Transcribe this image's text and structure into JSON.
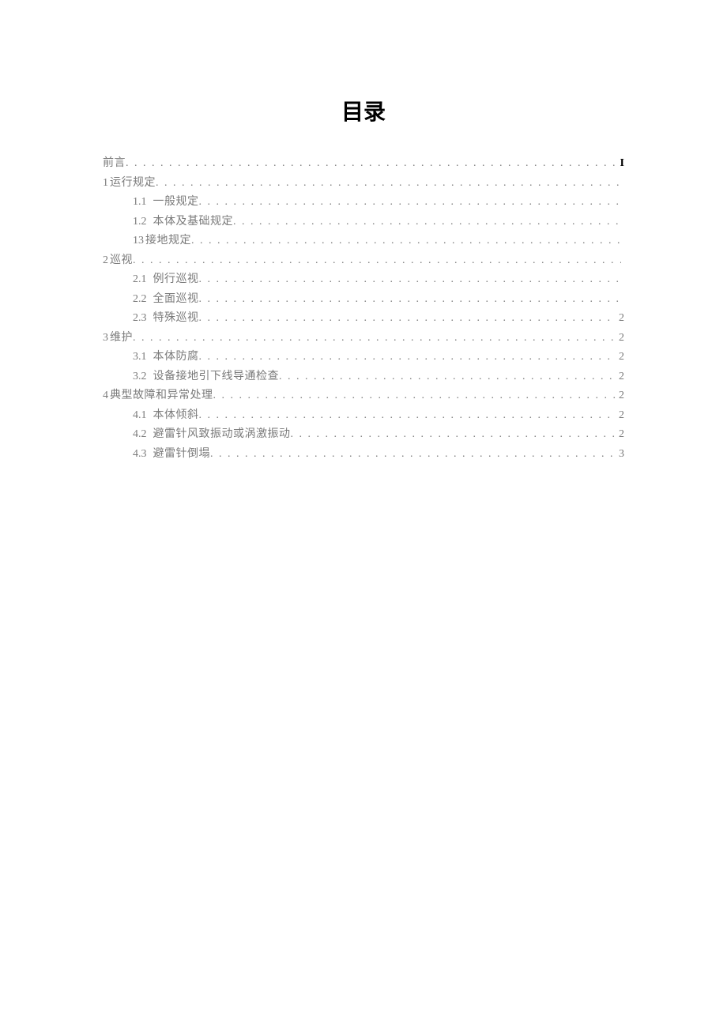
{
  "title": "目录",
  "entries": [
    {
      "level": 0,
      "num": "",
      "numTight": false,
      "title": "前言",
      "page": "I",
      "pageBold": true
    },
    {
      "level": 0,
      "num": "1",
      "numTight": true,
      "title": "运行规定",
      "page": "",
      "pageBold": false
    },
    {
      "level": 1,
      "num": "1.1",
      "numTight": false,
      "title": "一般规定",
      "page": "",
      "pageBold": false
    },
    {
      "level": 1,
      "num": "1.2",
      "numTight": false,
      "title": "本体及基础规定",
      "page": "",
      "pageBold": false
    },
    {
      "level": 1,
      "num": "13",
      "numTight": true,
      "title": "接地规定",
      "page": "",
      "pageBold": false
    },
    {
      "level": 0,
      "num": "2",
      "numTight": true,
      "title": "巡视",
      "page": "",
      "pageBold": false
    },
    {
      "level": 1,
      "num": "2.1",
      "numTight": false,
      "title": "例行巡视",
      "page": "",
      "pageBold": false
    },
    {
      "level": 1,
      "num": "2.2",
      "numTight": false,
      "title": "全面巡视",
      "page": "",
      "pageBold": false
    },
    {
      "level": 1,
      "num": "2.3",
      "numTight": false,
      "title": "特殊巡视",
      "page": "2",
      "pageBold": false
    },
    {
      "level": 0,
      "num": "3",
      "numTight": true,
      "title": "维护",
      "page": "2",
      "pageBold": false
    },
    {
      "level": 1,
      "num": "3.1",
      "numTight": false,
      "title": "本体防腐",
      "page": "2",
      "pageBold": false
    },
    {
      "level": 1,
      "num": "3.2",
      "numTight": false,
      "title": "设备接地引下线导通检查",
      "page": "2",
      "pageBold": false
    },
    {
      "level": 0,
      "num": "4",
      "numTight": true,
      "title": "典型故障和异常处理",
      "page": "2",
      "pageBold": false
    },
    {
      "level": 1,
      "num": "4.1",
      "numTight": false,
      "title": "本体倾斜",
      "page": "2",
      "pageBold": false
    },
    {
      "level": 1,
      "num": "4.2",
      "numTight": false,
      "title": "避雷针风致振动或涡激振动",
      "page": "2",
      "pageBold": false
    },
    {
      "level": 1,
      "num": "4.3",
      "numTight": false,
      "title": "避雷针倒塌",
      "page": "3",
      "pageBold": false
    }
  ]
}
